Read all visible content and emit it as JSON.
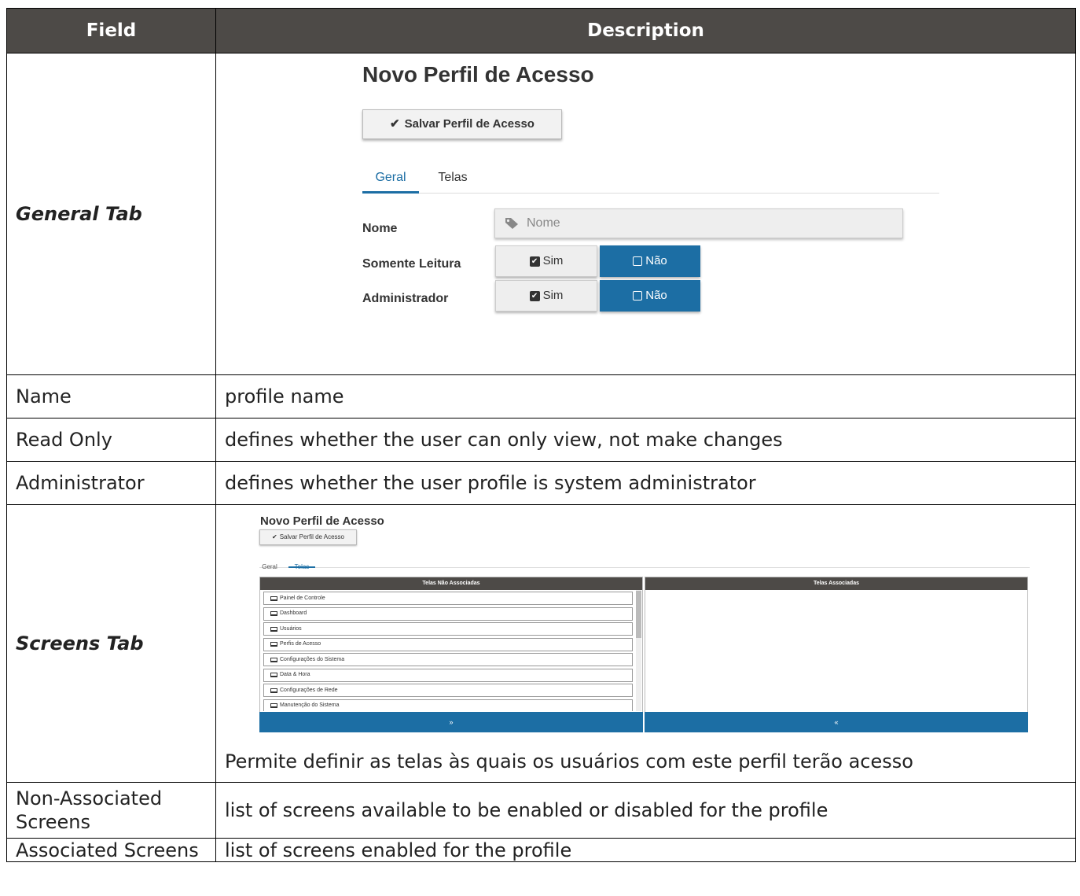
{
  "headers": {
    "field": "Field",
    "description": "Description"
  },
  "rows": {
    "general": {
      "field": "General Tab"
    },
    "name": {
      "field": "Name",
      "description": "profile name"
    },
    "read_only": {
      "field": "Read Only",
      "description": "defines whether the user can only view, not make changes"
    },
    "administrator": {
      "field": "Administrator",
      "description": "defines whether the user profile is system administrator"
    },
    "screens": {
      "field": "Screens Tab",
      "caption": "Permite definir as telas às quais os usuários com este perfil terão acesso"
    },
    "non_associated": {
      "field": "Non-Associated Screens",
      "description": "list of screens available to be enabled or disabled for the profile"
    },
    "associated": {
      "field": "Associated Screens",
      "description": "list of screens enabled for the profile"
    }
  },
  "general_mock": {
    "title": "Novo Perfil de Acesso",
    "save_label": "Salvar Perfil de Acesso",
    "tabs": [
      "Geral",
      "Telas"
    ],
    "nome_label": "Nome",
    "nome_placeholder": "Nome",
    "somente_leitura_label": "Somente Leitura",
    "administrador_label": "Administrador",
    "sim_label": "Sim",
    "nao_label": "Não"
  },
  "screens_mock": {
    "title": "Novo Perfil de Acesso",
    "save_label": "Salvar Perfil de Acesso",
    "tabs": [
      "Geral",
      "Telas"
    ],
    "left_header": "Telas Não Associadas",
    "right_header": "Telas Associadas",
    "items": [
      "Painel de Controle",
      "Dashboard",
      "Usuários",
      "Perfis de Acesso",
      "Configurações do Sistema",
      "Data & Hora",
      "Configurações de Rede",
      "Manutenção do Sistema"
    ],
    "move_right_label": "»",
    "move_left_label": "«"
  },
  "colors": {
    "header_bg": "#4d4a47",
    "accent": "#1c6ea4"
  }
}
